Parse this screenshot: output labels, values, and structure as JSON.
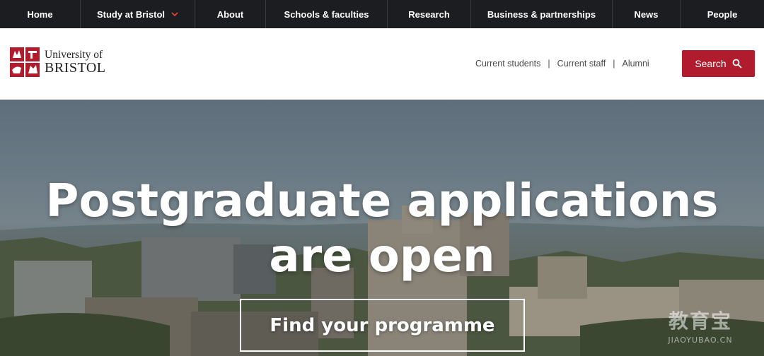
{
  "topnav": {
    "items": [
      {
        "label": "Home"
      },
      {
        "label": "Study at Bristol",
        "has_dropdown": true
      },
      {
        "label": "About"
      },
      {
        "label": "Schools & faculties"
      },
      {
        "label": "Research"
      },
      {
        "label": "Business & partnerships"
      },
      {
        "label": "News"
      },
      {
        "label": "People"
      }
    ]
  },
  "header": {
    "logo": {
      "line1": "University of",
      "line2": "BRISTOL",
      "icon": "university-crest-icon"
    },
    "utility_links": [
      "Current students",
      "Current staff",
      "Alumni"
    ],
    "utility_separator": "|",
    "search_label": "Search",
    "search_icon": "search-icon"
  },
  "hero": {
    "headline": "Postgraduate applications are open",
    "cta_label": "Find your programme"
  },
  "watermark": {
    "line1": "教育宝",
    "line2": "JIAOYUBAO.CN"
  },
  "colors": {
    "nav_bg": "#1c1d21",
    "accent": "#b01c2e",
    "dropdown_chevron": "#e0452c"
  }
}
